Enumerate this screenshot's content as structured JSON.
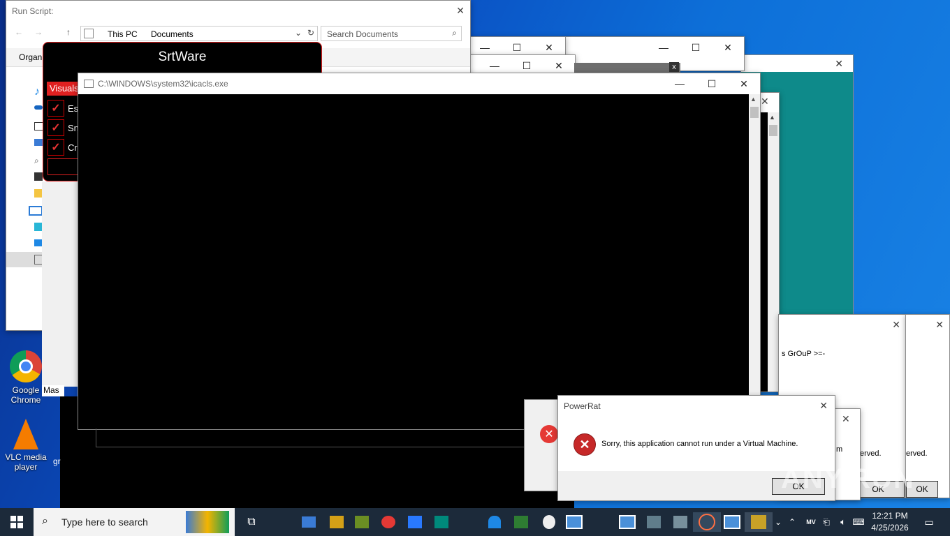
{
  "explorer": {
    "title": "Run Script:",
    "breadcrumb": [
      "This PC",
      "Documents"
    ],
    "search_placeholder": "Search Documents",
    "organize_label": "Organ"
  },
  "srtware": {
    "title": "SrtWare",
    "tab_label": "Visuals",
    "checks": [
      "Esp",
      "Sna",
      "Cre"
    ]
  },
  "icacls": {
    "title": "C:\\WINDOWS\\system32\\icacls.exe"
  },
  "bg_windows": {
    "group_text": "s GrOuP >=-",
    "served_left": "erved.",
    "served_right": "erved.",
    "m_text": "m",
    "master_label": "Mas",
    "close_symbol": "x"
  },
  "powerrat": {
    "title": "PowerRat",
    "message": "Sorry, this application cannot run under a Virtual Machine.",
    "ok": "OK"
  },
  "ok_buttons": [
    "OK",
    "OK"
  ],
  "desktop": {
    "icons": [
      {
        "label": "Google Chrome"
      },
      {
        "label": "VLC media player"
      }
    ],
    "partial_label": "gr"
  },
  "taskbar": {
    "search_placeholder": "Type here to search",
    "time": "12:21 PM",
    "date": "4/25/2026"
  },
  "watermark": "ANY.RUN",
  "colors": {
    "accent_red": "#e02020",
    "error_red": "#c62828",
    "teal": "#0e8a8a",
    "taskbar": "#1c2a3a"
  }
}
